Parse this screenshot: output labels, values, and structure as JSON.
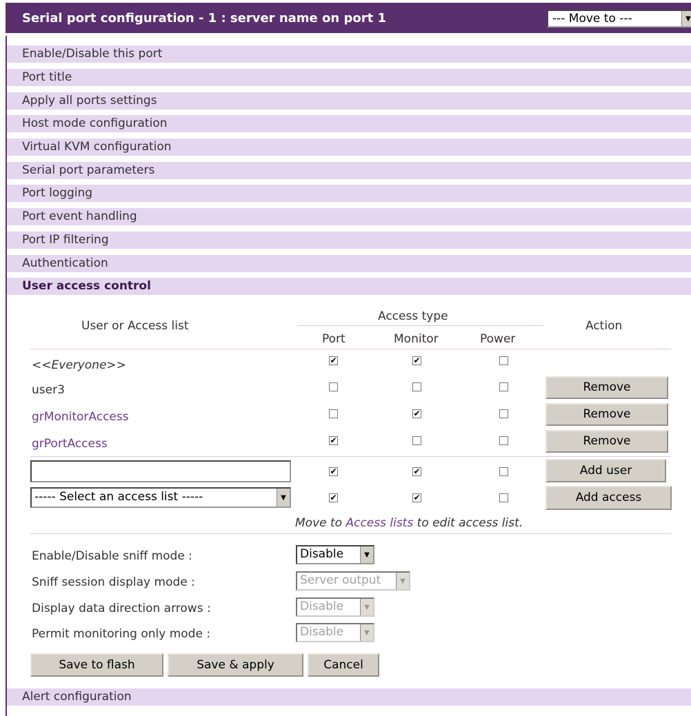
{
  "header": {
    "title": "Serial port configuration - 1 : server name on port 1",
    "move_to": "--- Move to ---"
  },
  "sections_top": [
    "Enable/Disable this port",
    "Port title",
    "Apply all ports settings",
    "Host mode configuration",
    "Virtual KVM configuration",
    "Serial port parameters",
    "Port logging",
    "Port event handling",
    "Port IP filtering",
    "Authentication"
  ],
  "active_section": "User access control",
  "table": {
    "col_user": "User or Access list",
    "col_access_type": "Access type",
    "col_port": "Port",
    "col_monitor": "Monitor",
    "col_power": "Power",
    "col_action": "Action",
    "rows": [
      {
        "name": "<<Everyone>>",
        "port": true,
        "monitor": true,
        "power": false,
        "action": ""
      },
      {
        "name": "user3",
        "port": false,
        "monitor": false,
        "power": false,
        "action": "Remove"
      },
      {
        "name": "grMonitorAccess",
        "port": false,
        "monitor": true,
        "power": false,
        "action": "Remove"
      },
      {
        "name": "grPortAccess",
        "port": true,
        "monitor": false,
        "power": false,
        "action": "Remove"
      }
    ],
    "add_user_value": "",
    "add_user_button": "Add user",
    "add_user_checks": {
      "port": true,
      "monitor": true,
      "power": false
    },
    "access_list_select": "----- Select an access list -----",
    "add_access_button": "Add access",
    "add_access_checks": {
      "port": true,
      "monitor": true,
      "power": false
    },
    "note_prefix": "Move to ",
    "note_link": "Access lists",
    "note_suffix": " to edit access list."
  },
  "settings": {
    "sniff_mode_label": "Enable/Disable sniff mode :",
    "sniff_mode_value": "Disable",
    "sniff_display_label": "Sniff session display mode :",
    "sniff_display_value": "Server output",
    "arrows_label": "Display data direction arrows :",
    "arrows_value": "Disable",
    "monitor_only_label": "Permit monitoring only mode :",
    "monitor_only_value": "Disable"
  },
  "buttons": {
    "save_flash": "Save to flash",
    "save_apply": "Save & apply",
    "cancel": "Cancel"
  },
  "sections_bottom": [
    "Alert configuration"
  ],
  "icons": {
    "check": "✔",
    "dropdown": "▼"
  }
}
